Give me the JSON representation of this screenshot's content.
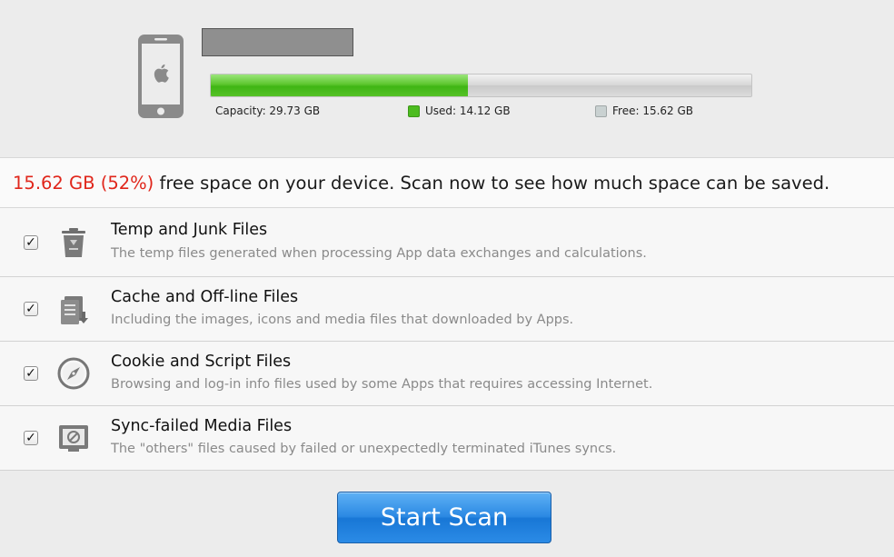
{
  "device": {
    "icon": "iphone-icon",
    "name": "",
    "capacity_label": "Capacity: 29.73 GB",
    "used_label": "Used: 14.12 GB",
    "free_label": "Free: 15.62 GB",
    "used_fraction": 0.475,
    "colors": {
      "used": "#4cbc1f",
      "free": "#c9d1d1"
    }
  },
  "summary": {
    "highlight": "15.62 GB (52%)",
    "message": " free space on your device. Scan now to see how much space can be saved.",
    "highlight_color": "#e0261b"
  },
  "categories": [
    {
      "icon": "trash-icon",
      "checked": true,
      "title": "Temp and Junk Files",
      "description": "The temp files generated when processing App data exchanges and calculations."
    },
    {
      "icon": "document-download-icon",
      "checked": true,
      "title": "Cache and Off-line Files",
      "description": "Including the images, icons and media files that downloaded by Apps."
    },
    {
      "icon": "compass-icon",
      "checked": true,
      "title": "Cookie and Script Files",
      "description": "Browsing and log-in info files used by some Apps that requires accessing Internet."
    },
    {
      "icon": "media-sync-icon",
      "checked": true,
      "title": "Sync-failed Media Files",
      "description": "The \"others\" files caused by failed or unexpectedly terminated iTunes syncs."
    }
  ],
  "actions": {
    "start_scan_label": "Start Scan",
    "accent": "#2b89e3"
  }
}
